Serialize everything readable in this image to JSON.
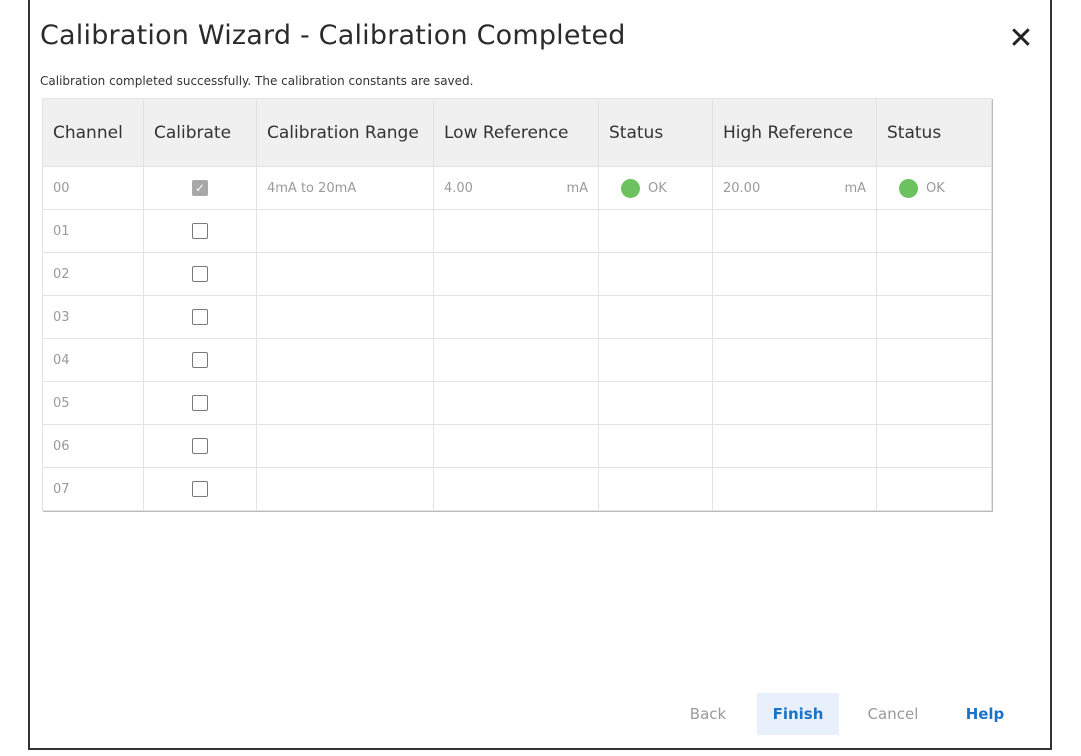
{
  "dialog": {
    "title": "Calibration Wizard -  Calibration Completed",
    "close_glyph": "✕",
    "subtitle": "Calibration completed successfully. The calibration constants are saved."
  },
  "table": {
    "headers": {
      "channel": "Channel",
      "calibrate": "Calibrate",
      "range": "Calibration Range",
      "low_ref": "Low Reference",
      "low_status": "Status",
      "high_ref": "High Reference",
      "high_status": "Status"
    },
    "rows": [
      {
        "channel": "00",
        "checked": true,
        "range": "4mA to 20mA",
        "low_value": "4.00",
        "low_unit": "mA",
        "low_status": "OK",
        "high_value": "20.00",
        "high_unit": "mA",
        "high_status": "OK"
      },
      {
        "channel": "01",
        "checked": false
      },
      {
        "channel": "02",
        "checked": false
      },
      {
        "channel": "03",
        "checked": false
      },
      {
        "channel": "04",
        "checked": false
      },
      {
        "channel": "05",
        "checked": false
      },
      {
        "channel": "06",
        "checked": false
      },
      {
        "channel": "07",
        "checked": false
      }
    ],
    "status_ok_color": "#6cc25f",
    "checkmark_glyph": "✓"
  },
  "buttons": {
    "back": "Back",
    "finish": "Finish",
    "cancel": "Cancel",
    "help": "Help"
  }
}
